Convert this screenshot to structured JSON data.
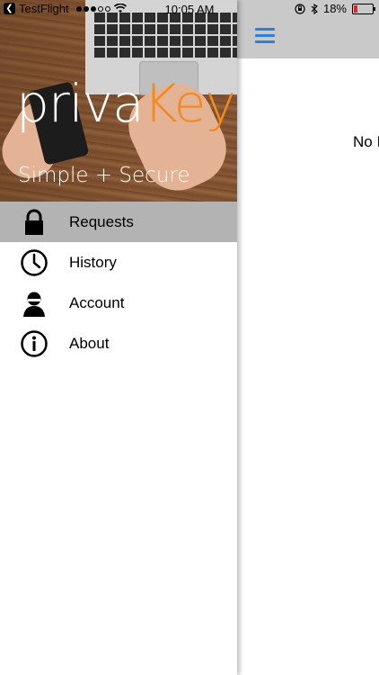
{
  "statusbar": {
    "back_app": "TestFlight",
    "time": "10:05 AM",
    "battery": "18%",
    "battery_level": 0.18,
    "battery_color": "#e0262a"
  },
  "drawer": {
    "logo_part1": "priva",
    "logo_part2": "Key",
    "logo_color_accent": "#f28b1e",
    "tagline": "Simple + Secure",
    "menu": [
      {
        "label": "Requests",
        "icon": "lock-icon",
        "active": true
      },
      {
        "label": "History",
        "icon": "clock-icon",
        "active": false
      },
      {
        "label": "Account",
        "icon": "user-icon",
        "active": false
      },
      {
        "label": "About",
        "icon": "info-icon",
        "active": false
      }
    ]
  },
  "main": {
    "menu_icon": "hamburger-icon",
    "accent": "#2a7fe0",
    "empty_text": "No I"
  }
}
